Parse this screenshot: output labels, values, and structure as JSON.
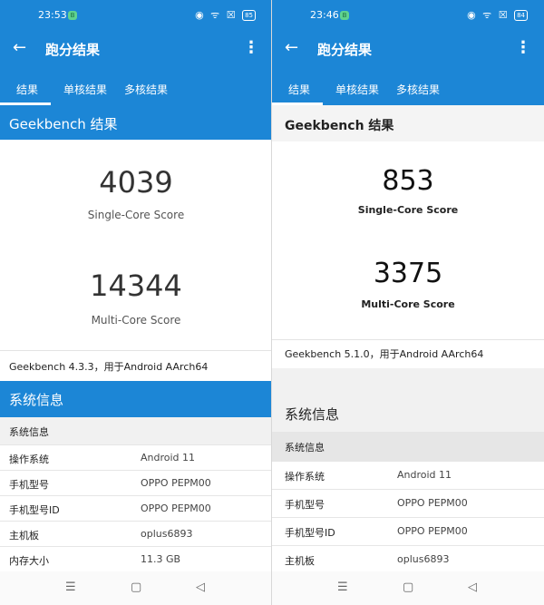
{
  "left": {
    "status": {
      "time": "23:53",
      "notif": "B",
      "icons": "◉ ᯤ ☒",
      "battery": "85"
    },
    "appbar": {
      "title": "跑分结果",
      "back": "←",
      "more": "⋮"
    },
    "tabs": [
      "结果",
      "单核结果",
      "多核结果"
    ],
    "header": "Geekbench 结果",
    "single": {
      "score": "4039",
      "label": "Single-Core Score"
    },
    "multi": {
      "score": "14344",
      "label": "Multi-Core Score"
    },
    "version": "Geekbench 4.3.3，用于Android AArch64",
    "sysinfo_header": "系统信息",
    "sysinfo_section": "系统信息",
    "rows": [
      {
        "k": "操作系统",
        "v": "Android 11"
      },
      {
        "k": "手机型号",
        "v": "OPPO PEPM00"
      },
      {
        "k": "手机型号ID",
        "v": "OPPO PEPM00"
      },
      {
        "k": "主机板",
        "v": "oplus6893"
      },
      {
        "k": "内存大小",
        "v": "11.3 GB"
      }
    ],
    "nav": [
      "☰",
      "▢",
      "◁"
    ]
  },
  "right": {
    "status": {
      "time": "23:46",
      "notif": "B",
      "icons": "◉ ᯤ ☒",
      "battery": "84"
    },
    "appbar": {
      "title": "跑分结果",
      "back": "←",
      "more": "⋮"
    },
    "tabs": [
      "结果",
      "单核结果",
      "多核结果"
    ],
    "header": "Geekbench 结果",
    "single": {
      "score": "853",
      "label": "Single-Core Score"
    },
    "multi": {
      "score": "3375",
      "label": "Multi-Core Score"
    },
    "version": "Geekbench 5.1.0，用于Android AArch64",
    "sysinfo_header": "系统信息",
    "sysinfo_section": "系统信息",
    "rows": [
      {
        "k": "操作系统",
        "v": "Android 11"
      },
      {
        "k": "手机型号",
        "v": "OPPO PEPM00"
      },
      {
        "k": "手机型号ID",
        "v": "OPPO PEPM00"
      },
      {
        "k": "主机板",
        "v": "oplus6893"
      }
    ],
    "nav": [
      "☰",
      "▢",
      "◁"
    ]
  }
}
